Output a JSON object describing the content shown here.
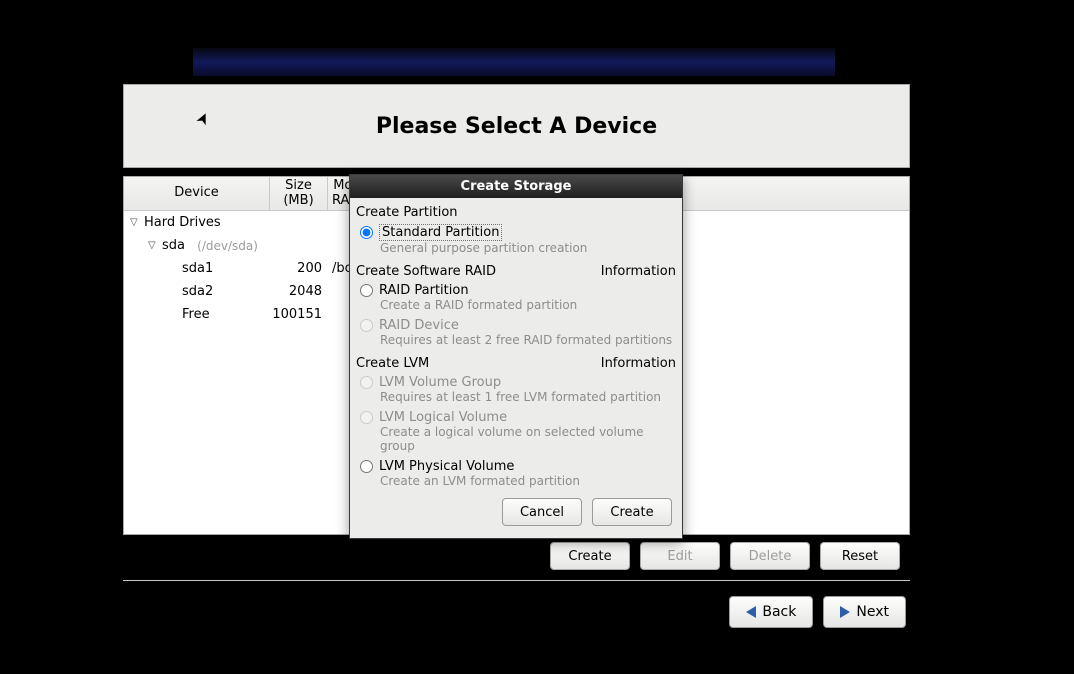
{
  "header": {
    "title": "Please Select A Device"
  },
  "columns": {
    "device": "Device",
    "size": "Size\n(MB)",
    "mount": "Mount Point/\nRAID/Volume"
  },
  "tree": {
    "root": "Hard Drives",
    "disk": {
      "name": "sda",
      "hint": "(/dev/sda)"
    },
    "rows": [
      {
        "name": "sda1",
        "size": "200",
        "mount": "/boot"
      },
      {
        "name": "sda2",
        "size": "2048",
        "mount": ""
      },
      {
        "name": "Free",
        "size": "100151",
        "mount": ""
      }
    ]
  },
  "actions": {
    "create": "Create",
    "edit": "Edit",
    "delete": "Delete",
    "reset": "Reset"
  },
  "nav": {
    "back": "Back",
    "next": "Next"
  },
  "dialog": {
    "title": "Create Storage",
    "sections": {
      "partition": "Create Partition",
      "raid": "Create Software RAID",
      "lvm": "Create LVM",
      "info": "Information"
    },
    "options": {
      "standard": {
        "label": "Standard Partition",
        "desc": "General purpose partition creation"
      },
      "raidpart": {
        "label": "RAID Partition",
        "desc": "Create a RAID formated partition"
      },
      "raiddev": {
        "label": "RAID Device",
        "desc": "Requires at least 2 free RAID formated partitions"
      },
      "lvmvg": {
        "label": "LVM Volume Group",
        "desc": "Requires at least 1 free LVM formated partition"
      },
      "lvmlv": {
        "label": "LVM Logical Volume",
        "desc": "Create a logical volume on selected volume group"
      },
      "lvmpv": {
        "label": "LVM Physical Volume",
        "desc": "Create an LVM formated partition"
      }
    },
    "buttons": {
      "cancel": "Cancel",
      "create": "Create"
    }
  }
}
